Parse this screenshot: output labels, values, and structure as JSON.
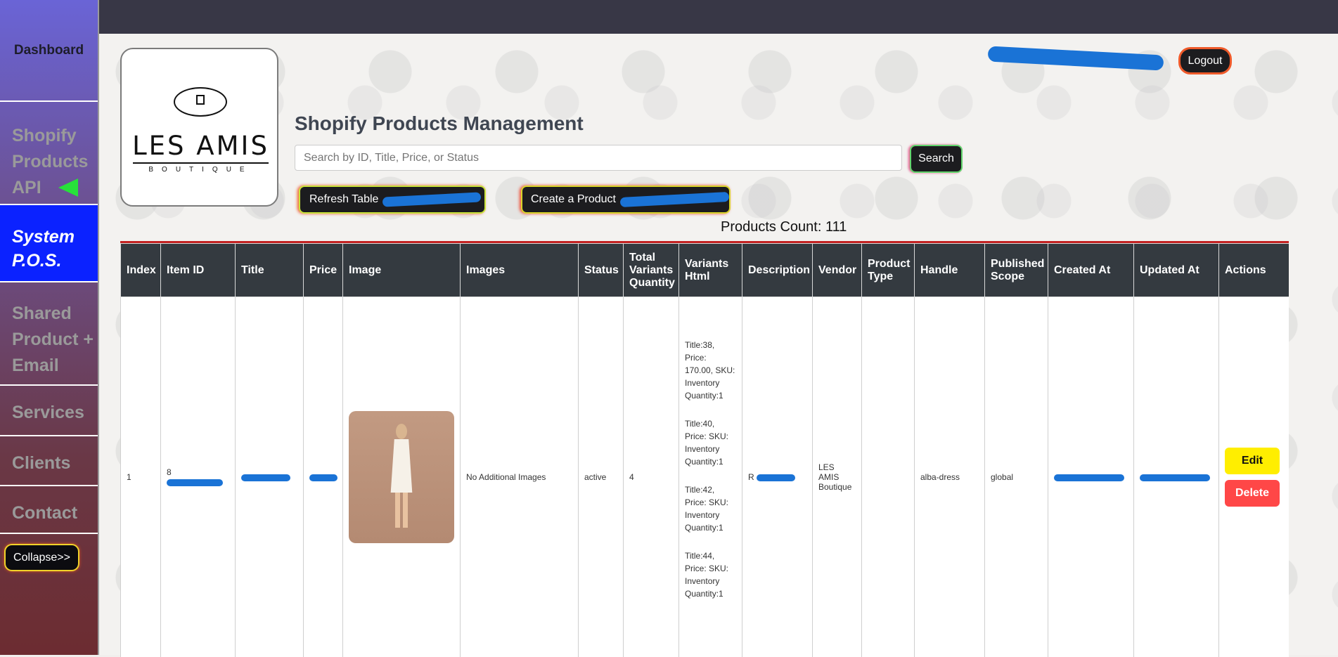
{
  "sidebar": {
    "dashboard": "Dashboard",
    "items": [
      {
        "label": "Shopify Products API"
      },
      {
        "label": "System P.O.S."
      },
      {
        "label": "Shared Product + Email"
      },
      {
        "label": "Services"
      },
      {
        "label": "Clients"
      },
      {
        "label": "Contact"
      }
    ],
    "collapse": "Collapse>>"
  },
  "header": {
    "logout": "Logout"
  },
  "logo": {
    "name": "LES AMIS",
    "sub": "BOUTIQUE"
  },
  "main": {
    "title": "Shopify Products Management",
    "search_placeholder": "Search by ID, Title, Price, or Status",
    "search_button": "Search",
    "refresh_button": "Refresh Table",
    "create_button": "Create a Product",
    "count": "Products Count: 111"
  },
  "table": {
    "headers": [
      "Index",
      "Item ID",
      "Title",
      "Price",
      "Image",
      "Images",
      "Status",
      "Total Variants Quantity",
      "Variants Html",
      "Description",
      "Vendor",
      "Product Type",
      "Handle",
      "Published Scope",
      "Created At",
      "Updated At",
      "Actions"
    ],
    "row": {
      "index": "1",
      "item_id": "8",
      "images": "No Additional Images",
      "status": "active",
      "total_variants": "4",
      "variants": [
        "Title:38, Price: 170.00, SKU: Inventory Quantity:1",
        "Title:40, Price: SKU: Inventory Quantity:1",
        "Title:42, Price: SKU: Inventory Quantity:1",
        "Title:44, Price: SKU: Inventory Quantity:1"
      ],
      "description": "R",
      "vendor": "LES AMIS Boutique",
      "handle": "alba-dress",
      "scope": "global",
      "edit": "Edit",
      "delete": "Delete"
    }
  },
  "colors": {
    "accent_blue": "#0b22ff",
    "edit_yellow": "#ffee00",
    "delete_red": "#ff4747"
  }
}
